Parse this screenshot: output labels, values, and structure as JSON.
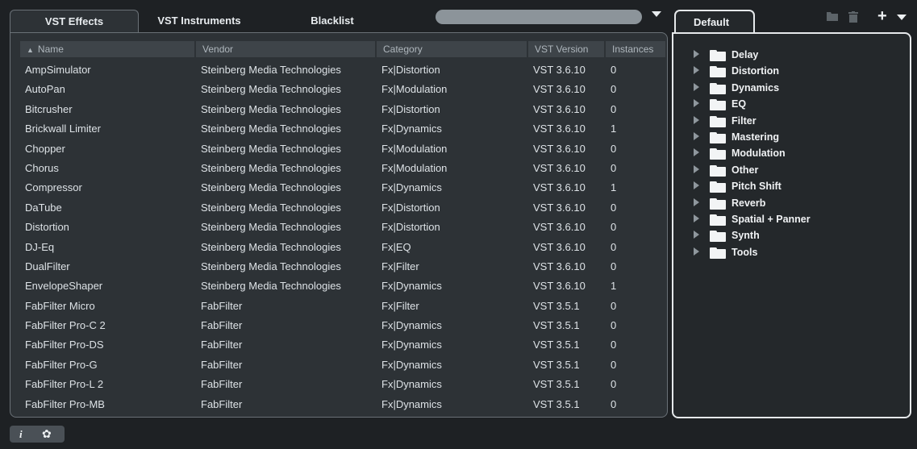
{
  "tabs": [
    "VST Effects",
    "VST Instruments",
    "Blacklist"
  ],
  "columns": {
    "name": "Name",
    "vendor": "Vendor",
    "category": "Category",
    "version": "VST Version",
    "instances": "Instances",
    "sort_glyph": "▲"
  },
  "plugins": [
    {
      "name": "AmpSimulator",
      "vendor": "Steinberg Media Technologies",
      "category": "Fx|Distortion",
      "version": "VST 3.6.10",
      "instances": "0"
    },
    {
      "name": "AutoPan",
      "vendor": "Steinberg Media Technologies",
      "category": "Fx|Modulation",
      "version": "VST 3.6.10",
      "instances": "0"
    },
    {
      "name": "Bitcrusher",
      "vendor": "Steinberg Media Technologies",
      "category": "Fx|Distortion",
      "version": "VST 3.6.10",
      "instances": "0"
    },
    {
      "name": "Brickwall Limiter",
      "vendor": "Steinberg Media Technologies",
      "category": "Fx|Dynamics",
      "version": "VST 3.6.10",
      "instances": "1"
    },
    {
      "name": "Chopper",
      "vendor": "Steinberg Media Technologies",
      "category": "Fx|Modulation",
      "version": "VST 3.6.10",
      "instances": "0"
    },
    {
      "name": "Chorus",
      "vendor": "Steinberg Media Technologies",
      "category": "Fx|Modulation",
      "version": "VST 3.6.10",
      "instances": "0"
    },
    {
      "name": "Compressor",
      "vendor": "Steinberg Media Technologies",
      "category": "Fx|Dynamics",
      "version": "VST 3.6.10",
      "instances": "1"
    },
    {
      "name": "DaTube",
      "vendor": "Steinberg Media Technologies",
      "category": "Fx|Distortion",
      "version": "VST 3.6.10",
      "instances": "0"
    },
    {
      "name": "Distortion",
      "vendor": "Steinberg Media Technologies",
      "category": "Fx|Distortion",
      "version": "VST 3.6.10",
      "instances": "0"
    },
    {
      "name": "DJ-Eq",
      "vendor": "Steinberg Media Technologies",
      "category": "Fx|EQ",
      "version": "VST 3.6.10",
      "instances": "0"
    },
    {
      "name": "DualFilter",
      "vendor": "Steinberg Media Technologies",
      "category": "Fx|Filter",
      "version": "VST 3.6.10",
      "instances": "0"
    },
    {
      "name": "EnvelopeShaper",
      "vendor": "Steinberg Media Technologies",
      "category": "Fx|Dynamics",
      "version": "VST 3.6.10",
      "instances": "1"
    },
    {
      "name": "FabFilter Micro",
      "vendor": "FabFilter",
      "category": "Fx|Filter",
      "version": "VST 3.5.1",
      "instances": "0"
    },
    {
      "name": "FabFilter Pro-C 2",
      "vendor": "FabFilter",
      "category": "Fx|Dynamics",
      "version": "VST 3.5.1",
      "instances": "0"
    },
    {
      "name": "FabFilter Pro-DS",
      "vendor": "FabFilter",
      "category": "Fx|Dynamics",
      "version": "VST 3.5.1",
      "instances": "0"
    },
    {
      "name": "FabFilter Pro-G",
      "vendor": "FabFilter",
      "category": "Fx|Dynamics",
      "version": "VST 3.5.1",
      "instances": "0"
    },
    {
      "name": "FabFilter Pro-L 2",
      "vendor": "FabFilter",
      "category": "Fx|Dynamics",
      "version": "VST 3.5.1",
      "instances": "0"
    },
    {
      "name": "FabFilter Pro-MB",
      "vendor": "FabFilter",
      "category": "Fx|Dynamics",
      "version": "VST 3.5.1",
      "instances": "0"
    }
  ],
  "right": {
    "tab": "Default",
    "plus": "+",
    "folders": [
      "Delay",
      "Distortion",
      "Dynamics",
      "EQ",
      "Filter",
      "Mastering",
      "Modulation",
      "Other",
      "Pitch Shift",
      "Reverb",
      "Spatial + Panner",
      "Synth",
      "Tools"
    ]
  },
  "bottom": {
    "info": "i",
    "gear": "✿"
  },
  "colors": {
    "background": "#1e2124",
    "panel": "#2d3236",
    "header": "#3e4449",
    "search": "#8c949a",
    "highlight_border": "#e6e9eb"
  },
  "icons": [
    "search-dropdown-arrow-icon",
    "new-folder-icon",
    "trash-icon",
    "plus-icon",
    "chevron-down-icon",
    "folder-icon",
    "info-icon",
    "gear-icon"
  ]
}
